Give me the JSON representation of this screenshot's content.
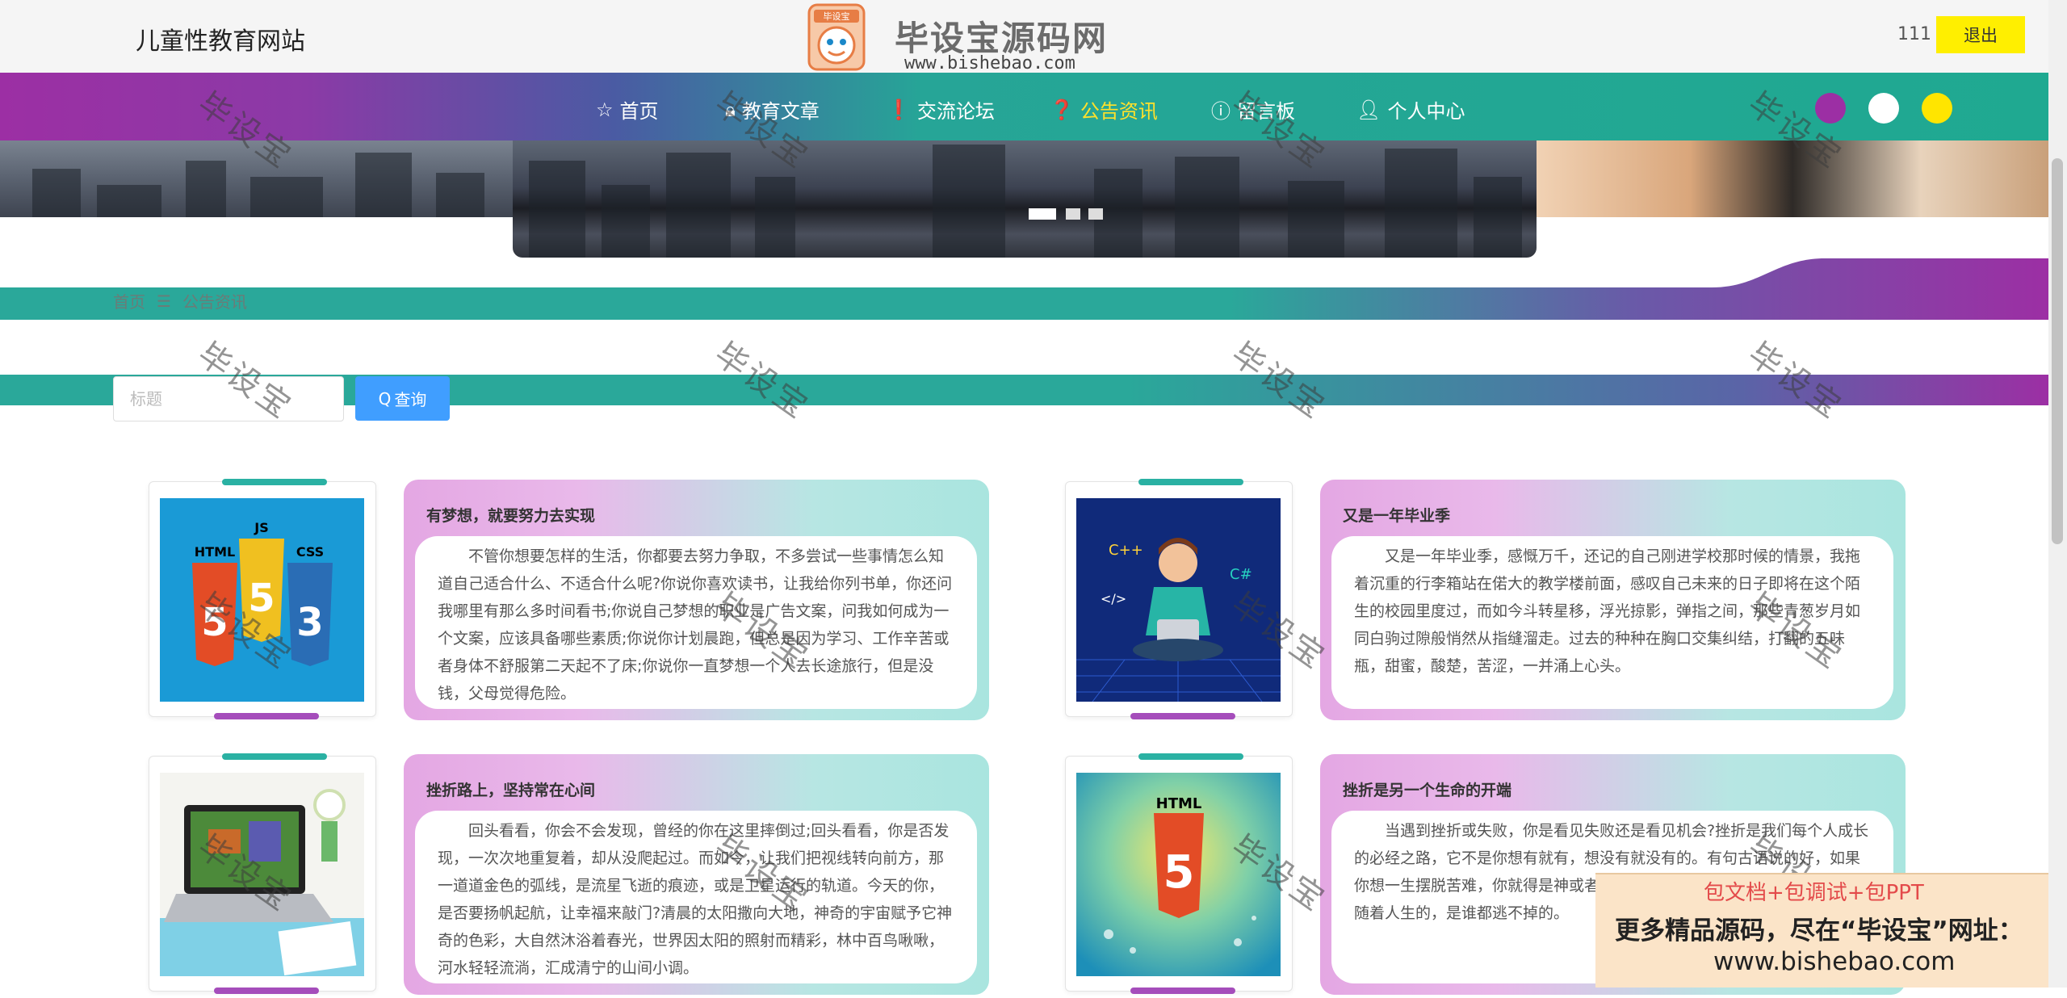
{
  "site": {
    "title": "儿童性教育网站"
  },
  "logo": {
    "badge": "毕设宝",
    "text": "毕设宝源码网",
    "url": "www.bishebao.com"
  },
  "user": {
    "name": "111",
    "logout_label": "退出"
  },
  "nav": {
    "items": [
      {
        "label": "首页",
        "icon": "star-icon"
      },
      {
        "label": "教育文章",
        "icon": "lock-icon"
      },
      {
        "label": "交流论坛",
        "icon": "info-icon"
      },
      {
        "label": "公告资讯",
        "icon": "question-icon",
        "active": true
      },
      {
        "label": "留言板",
        "icon": "info-icon"
      },
      {
        "label": "个人中心",
        "icon": "user-icon"
      }
    ],
    "theme_dots": [
      "#9c2fa4",
      "#ffffff",
      "#ffe500"
    ]
  },
  "breadcrumb": {
    "home": "首页",
    "separator": "☰",
    "current": "公告资讯"
  },
  "search": {
    "placeholder": "标题",
    "button_label": "查询"
  },
  "cards": [
    {
      "title": "有梦想，就要努力去实现",
      "body": "不管你想要怎样的生活，你都要去努力争取，不多尝试一些事情怎么知道自己适合什么、不适合什么呢?你说你喜欢读书，让我给你列书单，你还问我哪里有那么多时间看书;你说自己梦想的职业是广告文案，问我如何成为一个文案，应该具备哪些素质;你说你计划晨跑，但总是因为学习、工作辛苦或者身体不舒服第二天起不了床;你说你一直梦想一个人去长途旅行，但是没钱，父母觉得危险。"
    },
    {
      "title": "又是一年毕业季",
      "body": "又是一年毕业季，感慨万千，还记的自己刚进学校那时候的情景，我拖着沉重的行李箱站在偌大的教学楼前面，感叹自己未来的日子即将在这个陌生的校园里度过，而如今斗转星移，浮光掠影，弹指之间，那些青葱岁月如同白驹过隙般悄然从指缝溜走。过去的种种在胸口交集纠结，打翻的五味瓶，甜蜜，酸楚，苦涩，一并涌上心头。"
    },
    {
      "title": "挫折路上，坚持常在心间",
      "body": "回头看看，你会不会发现，曾经的你在这里摔倒过;回头看看，你是否发现，一次次地重复着，却从没爬起过。而如今，让我们把视线转向前方，那一道道金色的弧线，是流星飞逝的痕迹，或是卫星运行的轨道。今天的你，是否要扬帆起航，让幸福来敲门?清晨的太阳撒向大地，神奇的宇宙赋予它神奇的色彩，大自然沐浴着春光，世界因太阳的照射而精彩，林中百鸟啾啾，河水轻轻流淌，汇成清宁的山间小调。"
    },
    {
      "title": "挫折是另一个生命的开端",
      "body": "当遇到挫折或失败，你是看见失败还是看见机会?挫折是我们每个人成长的必经之路，它不是你想有就有，想没有就没有的。有句古语说的好，如果你想一生摆脱苦难，你就得是神或者是死尸。这句话形象地说明了挫折是伴随着人生的，是谁都逃不掉的。"
    }
  ],
  "watermark": "毕设宝",
  "promo": {
    "line1": "包文档+包调试+包PPT",
    "line2": "更多精品源码，尽在“毕设宝”网址：",
    "line3": "www.bishebao.com"
  }
}
